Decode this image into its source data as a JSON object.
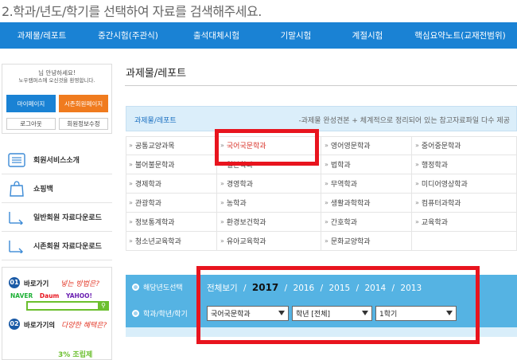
{
  "step_title": "2.학과/년도/학기를 선택하여 자료를 검색해주세요.",
  "nav": [
    "과제물/레포트",
    "중간시험(주관식)",
    "출석대체시험",
    "기말시험",
    "계절시험",
    "핵심요약노트(교재전범위)"
  ],
  "login": {
    "greeting": "님 안녕하세요!",
    "welcome": "노우캠퍼스에 오신것을 환영합니다.",
    "mypage": "마이페이지",
    "member_page": "시존회원페이지",
    "logout": "로그아웃",
    "edit_info": "회원정보수정"
  },
  "side_menu": [
    "회원서비스소개",
    "쇼핑백",
    "일반회원 자료다운로드",
    "시존회원 자료다운로드"
  ],
  "banner": {
    "num1": "01",
    "text1": "바로가기",
    "hand1": "넣는 방법은?",
    "logos": [
      "NAVER",
      "Daum",
      "YAHOO!"
    ],
    "num2": "02",
    "text2": "바로가기의",
    "hand2": "다양한 혜택은?",
    "bottom": "3% 조립제"
  },
  "page_title": "과제물/레포트",
  "category_header": {
    "left": "과제물/레포트",
    "right": "-과제물 완성견본 + 체계적으로 정리되어 있는 참고자료파일 다수 제공"
  },
  "departments": [
    "공통교양과목",
    "국어국문학과",
    "영어영문학과",
    "중어중문학과",
    "불어불문학과",
    "일본학과",
    "법학과",
    "행정학과",
    "경제학과",
    "경영학과",
    "무역학과",
    "미디어영상학과",
    "관광학과",
    "농학과",
    "생활과학학과",
    "컴퓨터과학과",
    "정보통계학과",
    "환경보건학과",
    "간호학과",
    "교육학과",
    "청소년교육학과",
    "유아교육학과",
    "문화교양학과",
    ""
  ],
  "selected_department": "국어국문학과",
  "filter": {
    "year_label": "해당년도선택",
    "view_all": "전체보기",
    "years": [
      "2017",
      "2016",
      "2015",
      "2014",
      "2013"
    ],
    "active_year": "2017",
    "dept_label": "학과/학년/학기",
    "dept_select": "국어국문학과",
    "grade_select": "학년 [전체]",
    "term_select": "1학기"
  },
  "colors": {
    "nav_bg": "#1a82d4",
    "filter_bg": "#55b3e3",
    "highlight": "#e8141e",
    "selected_text": "#d9352b"
  }
}
